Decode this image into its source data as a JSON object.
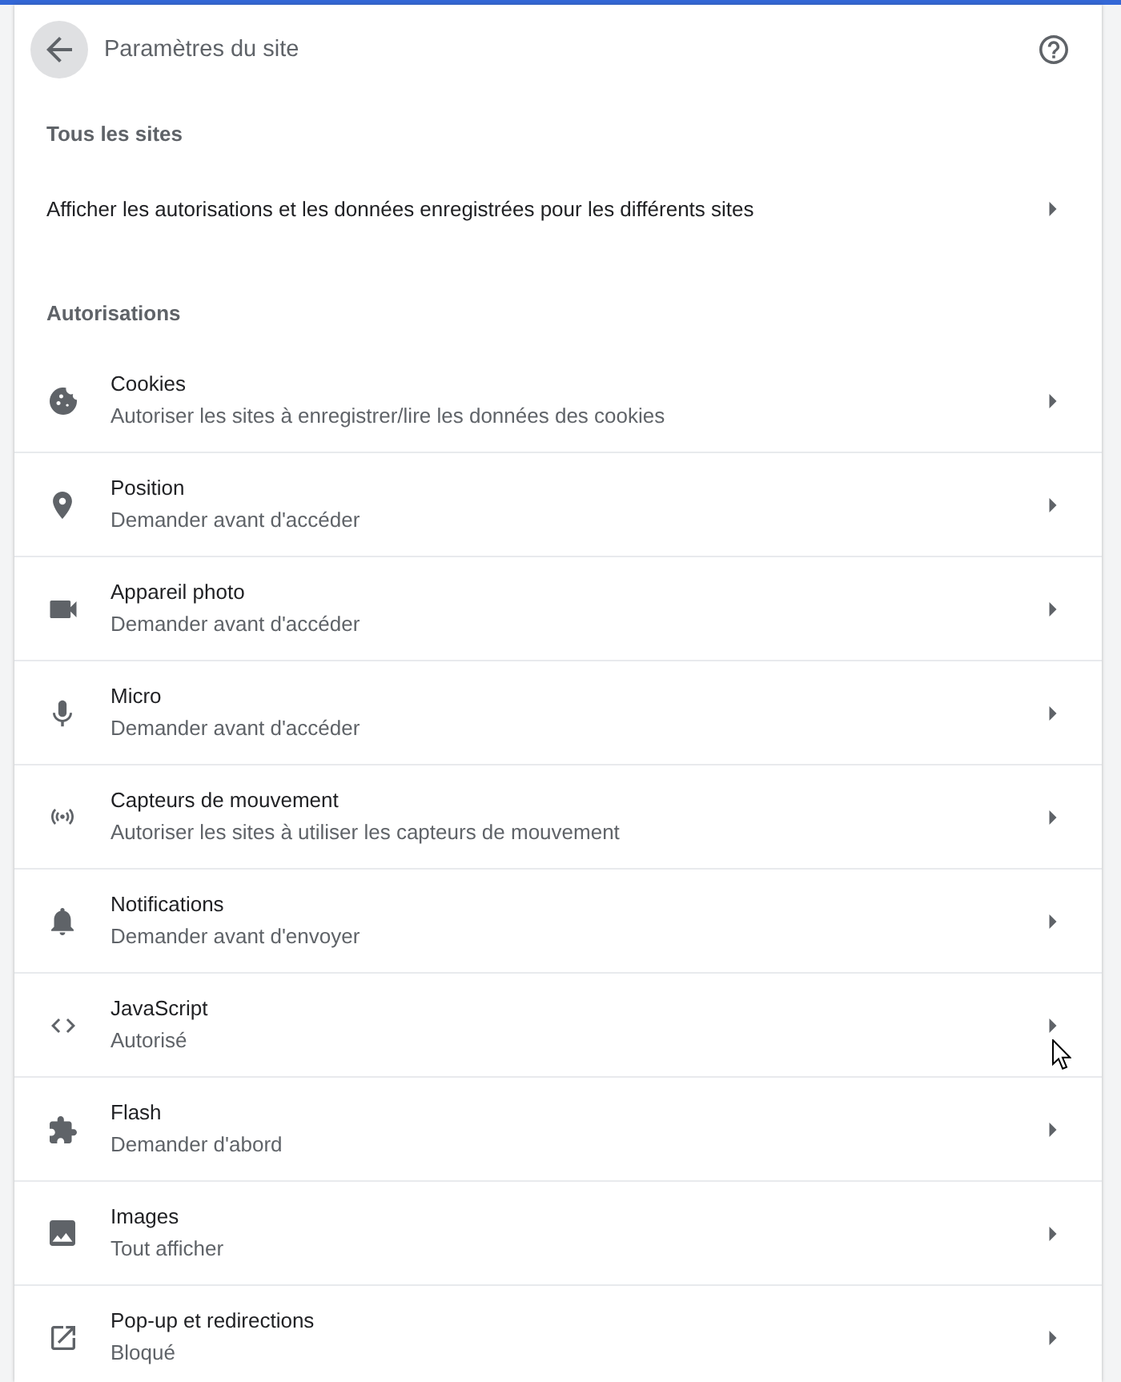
{
  "header": {
    "title": "Paramètres du site"
  },
  "all_sites": {
    "heading": "Tous les sites",
    "link": "Afficher les autorisations et les données enregistrées pour les différents sites"
  },
  "permissions": {
    "heading": "Autorisations",
    "items": [
      {
        "title": "Cookies",
        "subtitle": "Autoriser les sites à enregistrer/lire les données des cookies"
      },
      {
        "title": "Position",
        "subtitle": "Demander avant d'accéder"
      },
      {
        "title": "Appareil photo",
        "subtitle": "Demander avant d'accéder"
      },
      {
        "title": "Micro",
        "subtitle": "Demander avant d'accéder"
      },
      {
        "title": "Capteurs de mouvement",
        "subtitle": "Autoriser les sites à utiliser les capteurs de mouvement"
      },
      {
        "title": "Notifications",
        "subtitle": "Demander avant d'envoyer"
      },
      {
        "title": "JavaScript",
        "subtitle": "Autorisé"
      },
      {
        "title": "Flash",
        "subtitle": "Demander d'abord"
      },
      {
        "title": "Images",
        "subtitle": "Tout afficher"
      },
      {
        "title": "Pop-up et redirections",
        "subtitle": "Bloqué"
      }
    ]
  }
}
